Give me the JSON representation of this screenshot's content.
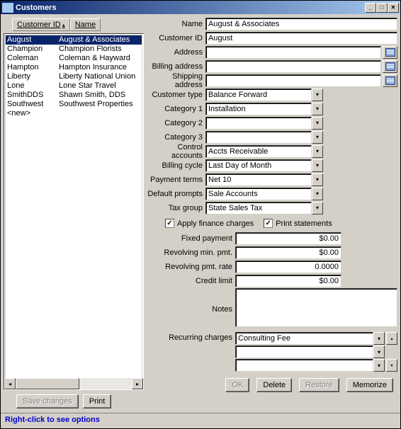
{
  "title": "Customers",
  "headers": {
    "id": "Customer ID",
    "name": "Name"
  },
  "list": [
    {
      "id": "August",
      "name": "August & Associates",
      "selected": true
    },
    {
      "id": "Champion",
      "name": "Champion Florists"
    },
    {
      "id": "Coleman",
      "name": "Coleman & Hayward"
    },
    {
      "id": "Hampton",
      "name": "Hampton Insurance"
    },
    {
      "id": "Liberty",
      "name": "Liberty National Union"
    },
    {
      "id": "Lone",
      "name": "Lone Star Travel"
    },
    {
      "id": "SmithDDS",
      "name": "Shawn Smith, DDS"
    },
    {
      "id": "Southwest",
      "name": "Southwest Properties"
    },
    {
      "id": "<new>",
      "name": ""
    }
  ],
  "left_buttons": {
    "save": "Save changes",
    "print": "Print"
  },
  "form": {
    "name_label": "Name",
    "name_value": "August & Associates",
    "cid_label": "Customer ID",
    "cid_value": "August",
    "addr_label": "Address",
    "addr_value": "",
    "bill_addr_label": "Billing address",
    "bill_addr_value": "",
    "ship_addr_label": "Shipping address",
    "ship_addr_value": "",
    "ctype_label": "Customer type",
    "ctype_value": "Balance Forward",
    "cat1_label": "Category 1",
    "cat1_value": "Installation",
    "cat2_label": "Category 2",
    "cat2_value": "",
    "cat3_label": "Category 3",
    "cat3_value": "",
    "ctrl_label": "Control accounts",
    "ctrl_value": "Accts Receivable",
    "bcycle_label": "Billing cycle",
    "bcycle_value": "Last Day of Month",
    "pterms_label": "Payment terms",
    "pterms_value": "Net 10",
    "dprompts_label": "Default prompts",
    "dprompts_value": "Sale Accounts",
    "taxg_label": "Tax group",
    "taxg_value": "State Sales Tax",
    "cb_finance": "Apply finance charges",
    "cb_print": "Print statements",
    "fixed_label": "Fixed payment",
    "fixed_value": "$0.00",
    "revmin_label": "Revolving min. pmt.",
    "revmin_value": "$0.00",
    "revrate_label": "Revolving pmt. rate",
    "revrate_value": "0.0000",
    "credit_label": "Credit limit",
    "credit_value": "$0.00",
    "notes_label": "Notes",
    "notes_value": "",
    "recur_label": "Recurring charges",
    "recur_rows": [
      "Consulting Fee",
      "",
      ""
    ]
  },
  "bottom": {
    "ok": "OK",
    "delete": "Delete",
    "restore": "Restore",
    "memorize": "Memorize"
  },
  "footer": "Right-click to see options"
}
